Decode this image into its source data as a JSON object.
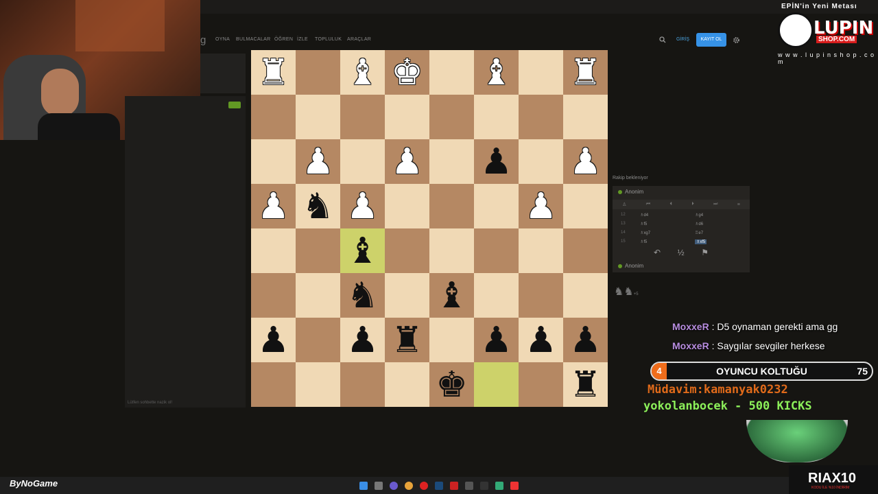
{
  "nav": {
    "logo_fragment": "g",
    "items": [
      "OYNA",
      "BULMACALAR",
      "ÖĞREN",
      "İZLE",
      "TOPLULUK",
      "ARAÇLAR"
    ],
    "login": "GİRİŞ",
    "signup": "KAYIT OL"
  },
  "chat_panel": {
    "placeholder": "Lütfen sohbette nazik ol!"
  },
  "board": {
    "highlight_color": "#cdd26a",
    "light_color": "#f0d9b5",
    "dark_color": "#b58863",
    "rows": [
      [
        "wR",
        "",
        "wB",
        "wK",
        "",
        "wB",
        "",
        "wR"
      ],
      [
        "",
        "",
        "",
        "",
        "",
        "",
        "",
        ""
      ],
      [
        "",
        "wP",
        "",
        "wP",
        "",
        "bP",
        "",
        "wP"
      ],
      [
        "wP",
        "bN",
        "wP",
        "",
        "",
        "",
        "wP",
        ""
      ],
      [
        "",
        "",
        "bB*",
        "",
        "",
        "",
        "",
        ""
      ],
      [
        "",
        "",
        "bN",
        "",
        "bB",
        "",
        "",
        ""
      ],
      [
        "bP",
        "",
        "bP",
        "bR",
        "",
        "bP",
        "bP",
        "bP"
      ],
      [
        "",
        "",
        "",
        "",
        "bK",
        "*",
        "",
        "bR"
      ]
    ]
  },
  "moves_panel": {
    "status": "Rakip bekleniyor",
    "top_player": "Anonim",
    "bottom_player": "Anonim",
    "moves": [
      {
        "num": "12",
        "white": "♗d4",
        "black": "♗g4"
      },
      {
        "num": "13",
        "white": "♗f5",
        "black": "♗d6"
      },
      {
        "num": "14",
        "white": "♗xg7",
        "black": "♖e7"
      },
      {
        "num": "15",
        "white": "♗f5",
        "black": "♗xf5"
      }
    ],
    "captured_label": "+5"
  },
  "overlay": {
    "chat": [
      {
        "user": "MoxxeR",
        "text": "D5 oynaman gerekti ama gg"
      },
      {
        "user": "MoxxeR",
        "text": "Saygılar sevgiler herkese"
      }
    ],
    "seat": {
      "number": "4",
      "title": "OYUNCU KOLTUĞU",
      "value": "75"
    },
    "ticker1": "Müdavim:kamanyak0232",
    "ticker2": "yokolanbocek - 500 KICKS"
  },
  "brand": {
    "top": "EPİN'in Yeni Metası",
    "name": "LUPIN",
    "sub": "SHOP.COM",
    "url": "w w w . l u p i n s h o p . c o m"
  },
  "taskbar": {
    "left_logo": "ByNoGame",
    "streamer": "RIAX10",
    "streamer_sub": "KODU İLE %10 İNDİRİM"
  }
}
